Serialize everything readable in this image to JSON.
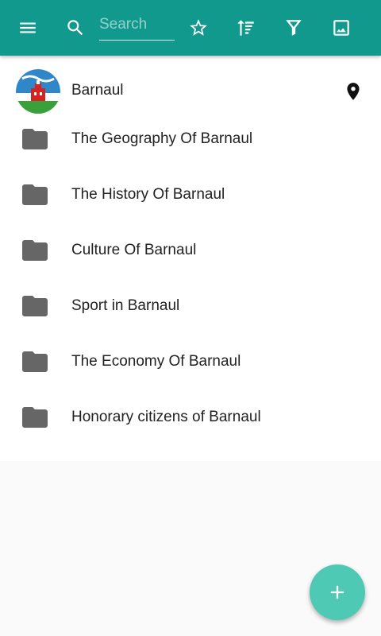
{
  "colors": {
    "toolbar": "#11998e",
    "fab": "#4dc9b4",
    "folder_icon": "#666666",
    "list_bg": "#ffffff",
    "page_bg": "#fafafa"
  },
  "toolbar": {
    "menu_icon": "hamburger-menu-icon",
    "search_icon": "search-icon",
    "search": {
      "placeholder": "Search",
      "value": ""
    },
    "favorite_icon": "star-outline-icon",
    "sort_icon": "sort-icon",
    "filter_icon": "filter-icon",
    "image_icon": "image-icon"
  },
  "list": {
    "header_item": {
      "label": "Barnaul",
      "avatar": "barnaul-coat-of-arms",
      "location_icon": "map-pin-icon"
    },
    "folders": [
      {
        "label": "The Geography Of Barnaul",
        "icon": "folder-icon"
      },
      {
        "label": "The History Of Barnaul",
        "icon": "folder-icon"
      },
      {
        "label": "Culture Of Barnaul",
        "icon": "folder-icon"
      },
      {
        "label": "Sport in Barnaul",
        "icon": "folder-icon"
      },
      {
        "label": "The Economy Of Barnaul",
        "icon": "folder-icon"
      },
      {
        "label": "Honorary citizens of Barnaul",
        "icon": "folder-icon"
      }
    ]
  },
  "fab": {
    "icon": "plus-icon"
  }
}
